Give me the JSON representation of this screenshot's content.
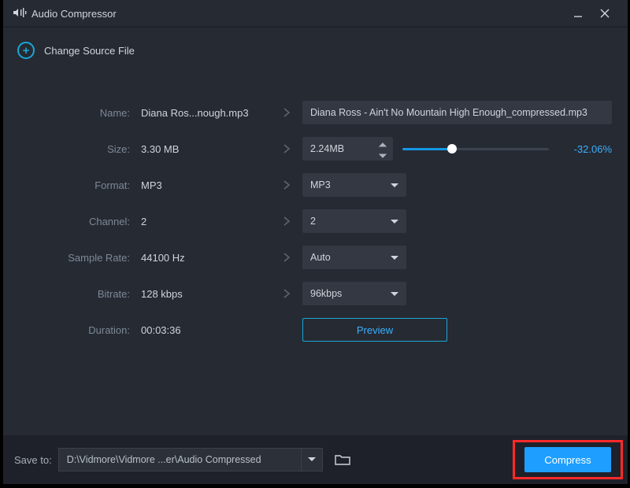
{
  "title": "Audio Compressor",
  "change_source_label": "Change Source File",
  "labels": {
    "name": "Name:",
    "size": "Size:",
    "format": "Format:",
    "channel": "Channel:",
    "sample_rate": "Sample Rate:",
    "bitrate": "Bitrate:",
    "duration": "Duration:"
  },
  "source": {
    "name": "Diana Ros...nough.mp3",
    "size": "3.30 MB",
    "format": "MP3",
    "channel": "2",
    "sample_rate": "44100 Hz",
    "bitrate": "128 kbps",
    "duration": "00:03:36"
  },
  "target": {
    "name": "Diana Ross - Ain't No Mountain High Enough_compressed.mp3",
    "size": "2.24MB",
    "size_change_pct": "-32.06%",
    "slider_pct": 34,
    "format": "MP3",
    "channel": "2",
    "sample_rate": "Auto",
    "bitrate": "96kbps"
  },
  "buttons": {
    "preview": "Preview",
    "compress": "Compress"
  },
  "footer": {
    "save_to_label": "Save to:",
    "save_path": "D:\\Vidmore\\Vidmore ...er\\Audio Compressed"
  }
}
